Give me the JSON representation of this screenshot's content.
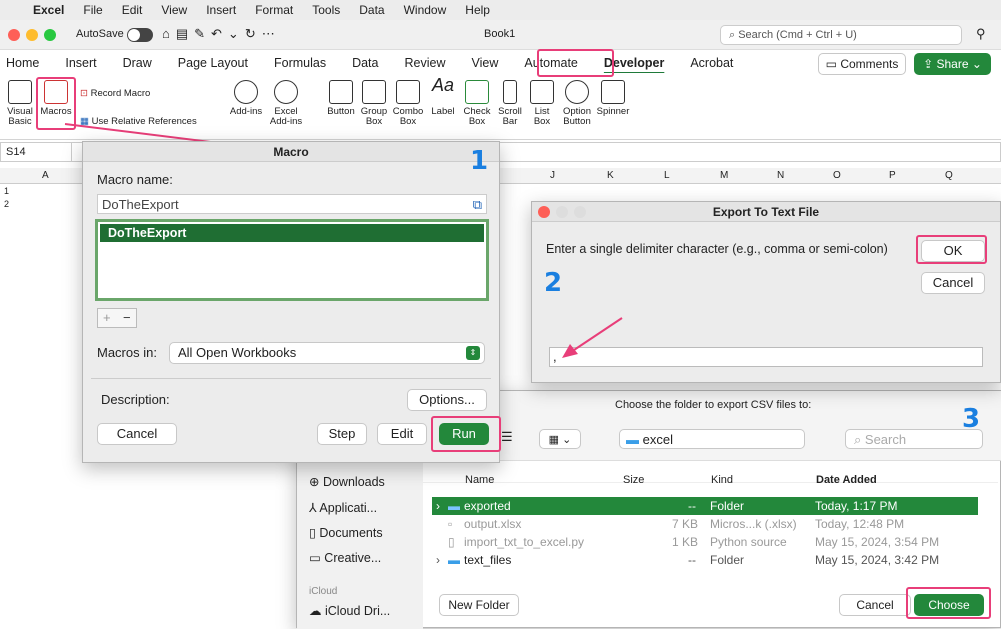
{
  "menubar": {
    "apple": "",
    "app": "Excel",
    "items": [
      "File",
      "Edit",
      "View",
      "Insert",
      "Format",
      "Tools",
      "Data",
      "Window",
      "Help"
    ]
  },
  "window": {
    "autosave": "AutoSave",
    "title": "Book1",
    "search": "Search (Cmd + Ctrl + U)",
    "comments": "Comments",
    "share": "Share"
  },
  "ribbon_tabs": [
    "Home",
    "Insert",
    "Draw",
    "Page Layout",
    "Formulas",
    "Data",
    "Review",
    "View",
    "Automate",
    "Developer",
    "Acrobat"
  ],
  "ribbon": {
    "visual_basic": "Visual Basic",
    "macros": "Macros",
    "record_macro": "Record Macro",
    "relative_refs": "Use Relative References",
    "addins": "Add-ins",
    "excel_addins": "Excel Add-ins",
    "button": "Button",
    "group_box": "Group Box",
    "combo_box": "Combo Box",
    "label": "Label",
    "check_box": "Check Box",
    "scroll_bar": "Scroll Bar",
    "list_box": "List Box",
    "option_button": "Option Button",
    "spinner": "Spinner"
  },
  "sheet": {
    "cell_ref": "S14",
    "columns": [
      "A",
      "J",
      "K",
      "L",
      "M",
      "N",
      "O",
      "P",
      "Q"
    ],
    "rows": [
      "1",
      "2"
    ]
  },
  "macro_dialog": {
    "title": "Macro",
    "name_label": "Macro name:",
    "name_value": "DoTheExport",
    "list": [
      "DoTheExport"
    ],
    "macros_in_label": "Macros in:",
    "macros_in_value": "All Open Workbooks",
    "description_label": "Description:",
    "options": "Options...",
    "cancel": "Cancel",
    "step": "Step",
    "edit": "Edit",
    "run": "Run"
  },
  "export_dialog": {
    "title": "Export To Text File",
    "prompt": "Enter a single delimiter character (e.g., comma or semi-colon)",
    "ok": "OK",
    "cancel": "Cancel",
    "input_value": ","
  },
  "folder_dialog": {
    "prompt": "Choose the folder to export CSV files to:",
    "folder": "excel",
    "search_placeholder": "Search",
    "headers": {
      "name": "Name",
      "size": "Size",
      "kind": "Kind",
      "date": "Date Added"
    },
    "sidebar": [
      "Downloads",
      "Applicati...",
      "Documents",
      "Creative..."
    ],
    "sidebar_section": "iCloud",
    "icloud": "iCloud Dri...",
    "files": [
      {
        "name": "exported",
        "size": "--",
        "kind": "Folder",
        "date": "Today, 1:17 PM"
      },
      {
        "name": "output.xlsx",
        "size": "7 KB",
        "kind": "Micros...k (.xlsx)",
        "date": "Today, 12:48 PM"
      },
      {
        "name": "import_txt_to_excel.py",
        "size": "1 KB",
        "kind": "Python source",
        "date": "May 15, 2024, 3:54 PM"
      },
      {
        "name": "text_files",
        "size": "--",
        "kind": "Folder",
        "date": "May 15, 2024, 3:42 PM"
      }
    ],
    "new_folder": "New Folder",
    "cancel": "Cancel",
    "choose": "Choose"
  },
  "steps": [
    "1",
    "2",
    "3"
  ]
}
